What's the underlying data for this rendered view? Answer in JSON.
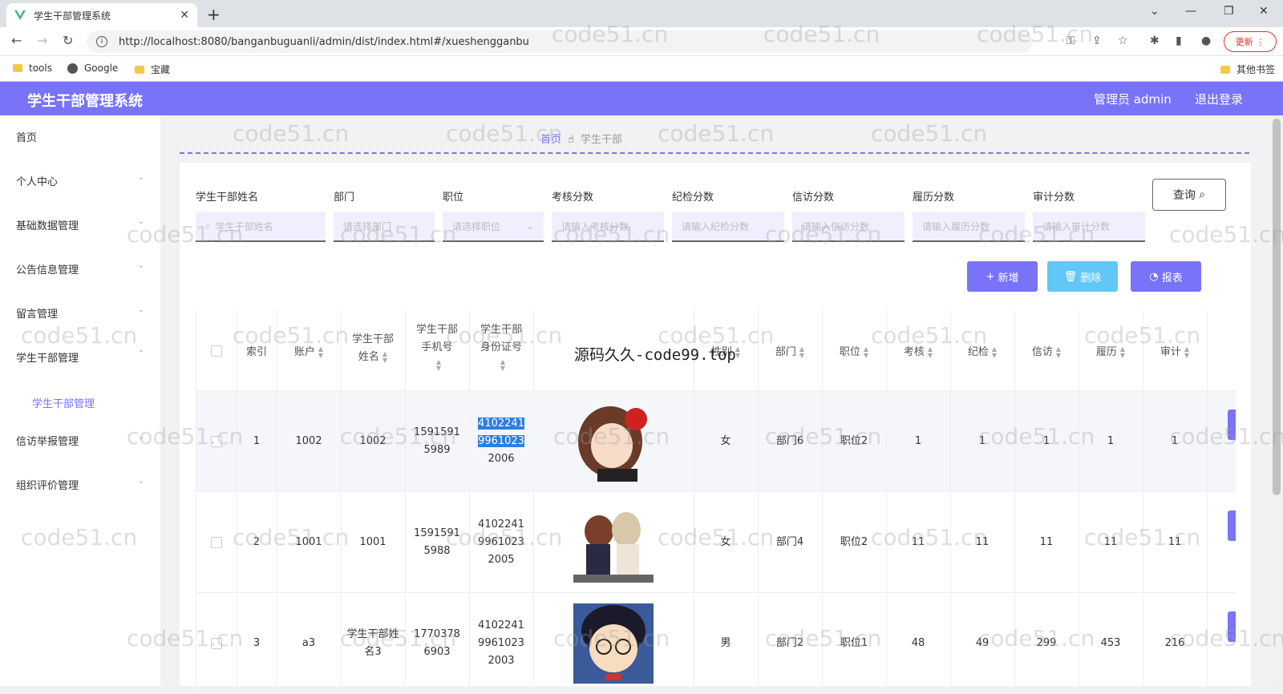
{
  "browser": {
    "tab_title": "学生干部管理系统",
    "url": "http://localhost:8080/banganbuguanli/admin/dist/index.html#/xueshengganbu",
    "update_label": "更新",
    "bookmarks": [
      "tools",
      "Google",
      "宝藏"
    ],
    "other_bookmarks": "其他书签"
  },
  "app": {
    "title": "学生干部管理系统",
    "user": "管理员 admin",
    "logout": "退出登录"
  },
  "sidebar": {
    "items": [
      {
        "label": "首页"
      },
      {
        "label": "个人中心"
      },
      {
        "label": "基础数据管理"
      },
      {
        "label": "公告信息管理"
      },
      {
        "label": "留言管理"
      },
      {
        "label": "学生干部管理"
      },
      {
        "label": "信访举报管理"
      },
      {
        "label": "组织评价管理"
      }
    ],
    "active_sub": "学生干部管理"
  },
  "breadcrumb": {
    "home": "首页",
    "current": "学生干部"
  },
  "filters": [
    {
      "label": "学生干部姓名",
      "placeholder": "学生干部姓名"
    },
    {
      "label": "部门",
      "placeholder": "请选择部门"
    },
    {
      "label": "职位",
      "placeholder": "请选择职位"
    },
    {
      "label": "考核分数",
      "placeholder": "请输入考核分数"
    },
    {
      "label": "纪检分数",
      "placeholder": "请输入纪检分数"
    },
    {
      "label": "信访分数",
      "placeholder": "请输入信访分数"
    },
    {
      "label": "履历分数",
      "placeholder": "请输入履历分数"
    },
    {
      "label": "审计分数",
      "placeholder": "请输入审计分数"
    }
  ],
  "buttons": {
    "query": "查询",
    "add": "新增",
    "delete": "删除",
    "report": "报表"
  },
  "colors": {
    "accent": "#7873f8",
    "delete": "#60c7f7"
  },
  "table": {
    "headers": [
      "索引",
      "账户",
      "学生干部姓名",
      "学生干部手机号",
      "学生干部身份证号",
      "",
      "性别",
      "部门",
      "职位",
      "考核",
      "纪检",
      "信访",
      "履历",
      "审计"
    ],
    "rows": [
      {
        "index": "1",
        "account": "1002",
        "name": "1002",
        "phone": "15915915989",
        "idcard": "410224119961023 2006",
        "gender": "女",
        "dept": "部门6",
        "position": "职位2",
        "kaohe": "1",
        "jijian": "1",
        "xinfang": "1",
        "lvli": "1",
        "shenji": "1"
      },
      {
        "index": "2",
        "account": "1001",
        "name": "1001",
        "phone": "15915915988",
        "idcard": "410224199610232005",
        "gender": "女",
        "dept": "部门4",
        "position": "职位2",
        "kaohe": "11",
        "jijian": "11",
        "xinfang": "11",
        "lvli": "11",
        "shenji": "11"
      },
      {
        "index": "3",
        "account": "a3",
        "name": "学生干部姓名3",
        "phone": "17703786903",
        "idcard": "410224199610232003",
        "gender": "男",
        "dept": "部门2",
        "position": "职位1",
        "kaohe": "48",
        "jijian": "49",
        "xinfang": "299",
        "lvli": "453",
        "shenji": "216"
      }
    ]
  },
  "overlay": "源码久久-code99.top",
  "watermark": "code51.cn"
}
